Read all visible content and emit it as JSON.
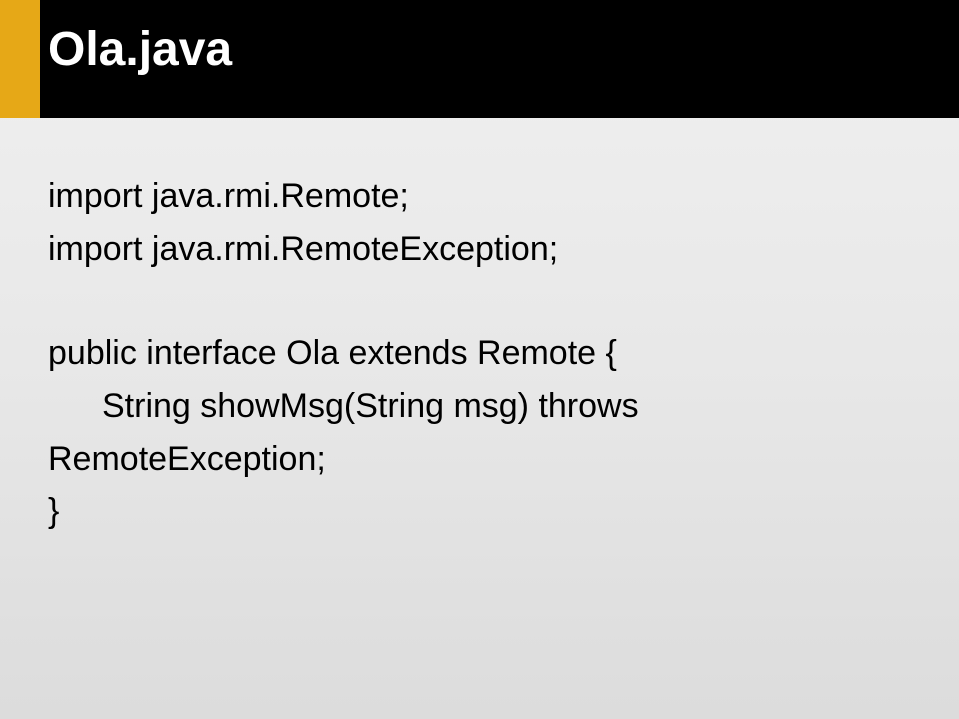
{
  "slide": {
    "title": "Ola.java",
    "code": {
      "line1": "import java.rmi.Remote;",
      "line2": "import java.rmi.RemoteException;",
      "line3": "public interface Ola extends Remote {",
      "line4": "String showMsg(String msg) throws",
      "line5": "RemoteException;",
      "line6": "}"
    }
  }
}
